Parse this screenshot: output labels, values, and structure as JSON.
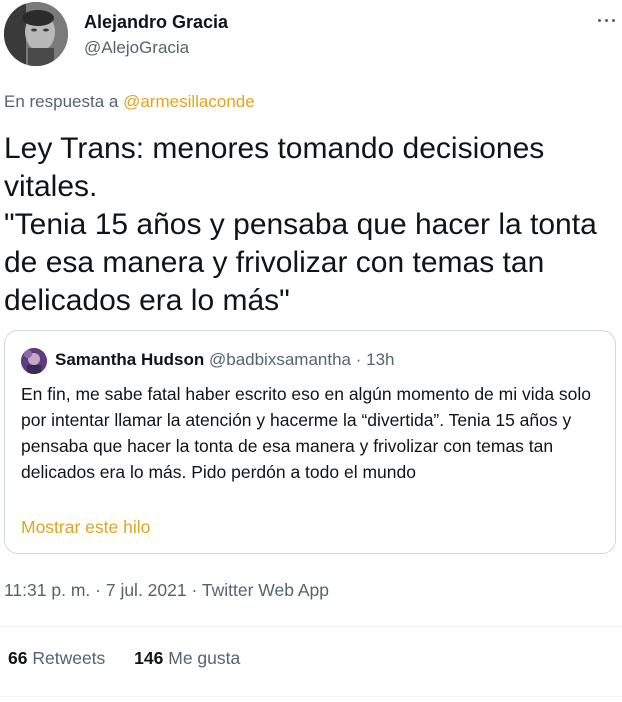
{
  "author": {
    "name": "Alejandro Gracia",
    "handle": "@AlejoGracia"
  },
  "reply": {
    "prefix": "En respuesta a",
    "to": "@armesillaconde"
  },
  "tweet": {
    "text": "Ley Trans: menores tomando decisiones vitales.\n\"Tenia 15 años y pensaba que hacer la tonta de esa manera y frivolizar con temas tan delicados era lo más\""
  },
  "quote": {
    "name": "Samantha Hudson",
    "handle": "@badbixsamantha",
    "separator": "·",
    "time": "13h",
    "text": "En fin, me sabe fatal haber escrito eso en algún momento de mi vida solo por intentar llamar la atención y hacerme la “divertida”. Tenia 15 años y pensaba que hacer la tonta de esa manera y frivolizar con temas tan delicados era lo más. Pido perdón a todo el mundo",
    "show_thread": "Mostrar este hilo"
  },
  "meta": {
    "time": "11:31 p. m.",
    "date": "7 jul. 2021",
    "source": "Twitter Web App",
    "separator": "·"
  },
  "stats": {
    "retweets_count": "66",
    "retweets_label": "Retweets",
    "likes_count": "146",
    "likes_label": "Me gusta"
  },
  "colors": {
    "link": "#e0a51d",
    "secondary_text": "#536471",
    "border": "#cfd9de"
  }
}
